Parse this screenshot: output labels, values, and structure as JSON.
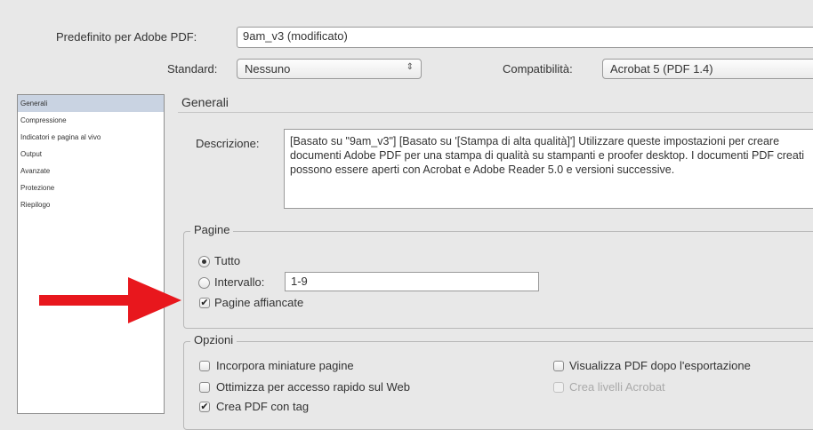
{
  "preset": {
    "label": "Predefinito per Adobe PDF:",
    "value": "9am_v3 (modificato)"
  },
  "standard": {
    "label": "Standard:",
    "value": "Nessuno"
  },
  "compatibility": {
    "label": "Compatibilità:",
    "value": "Acrobat 5 (PDF 1.4)"
  },
  "sidebar": {
    "items": [
      {
        "label": "Generali"
      },
      {
        "label": "Compressione"
      },
      {
        "label": "Indicatori e pagina al vivo"
      },
      {
        "label": "Output"
      },
      {
        "label": "Avanzate"
      },
      {
        "label": "Protezione"
      },
      {
        "label": "Riepilogo"
      }
    ]
  },
  "main": {
    "title": "Generali",
    "description_label": "Descrizione:",
    "description_text": "[Basato su \"9am_v3\"] [Basato su '[Stampa di alta qualità]'] Utilizzare queste impostazioni per creare documenti Adobe PDF per una stampa di qualità su stampanti e proofer desktop. I documenti PDF creati possono essere aperti con Acrobat e Adobe Reader 5.0 e versioni successive."
  },
  "pages": {
    "title": "Pagine",
    "all_label": "Tutto",
    "range_label": "Intervallo:",
    "range_value": "1-9",
    "spreads_label": "Pagine affiancate"
  },
  "options": {
    "title": "Opzioni",
    "embed_thumbs": "Incorpora miniature pagine",
    "optimize_web": "Ottimizza per accesso rapido sul Web",
    "tagged_pdf": "Crea PDF con tag",
    "view_after": "Visualizza PDF dopo l'esportazione",
    "acrobat_layers": "Crea livelli Acrobat"
  },
  "colors": {
    "arrow": "#e8171d",
    "sidebar_selection": "#c9d3e2"
  },
  "glyphs": {
    "check": "✔",
    "updown": "⇕",
    "dropdown": "▾"
  }
}
